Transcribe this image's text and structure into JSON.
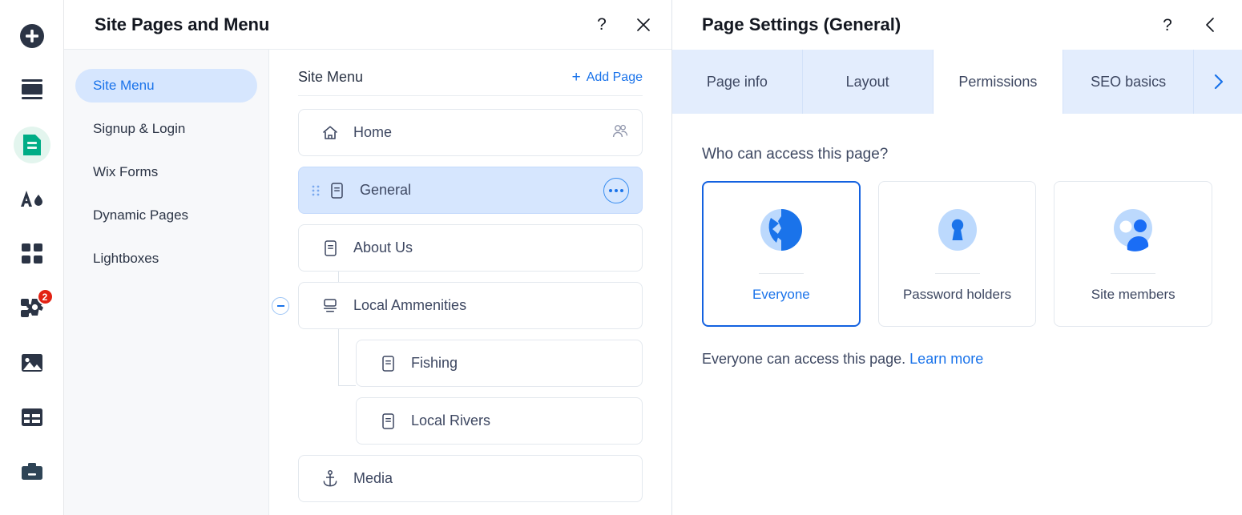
{
  "rail": {
    "items": [
      {
        "name": "add-elements",
        "icon": "plus-circle-icon",
        "active": false,
        "badge": null
      },
      {
        "name": "site-design",
        "icon": "layers-icon",
        "active": false,
        "badge": null
      },
      {
        "name": "pages-and-menu",
        "icon": "page-document-icon",
        "active": true,
        "badge": null
      },
      {
        "name": "site-theme",
        "icon": "text-and-color-icon",
        "active": false,
        "badge": null
      },
      {
        "name": "apps",
        "icon": "grid-squares-icon",
        "active": false,
        "badge": null
      },
      {
        "name": "app-market",
        "icon": "puzzle-gear-icon",
        "active": false,
        "badge": "2"
      },
      {
        "name": "media",
        "icon": "image-icon",
        "active": false,
        "badge": null
      },
      {
        "name": "content-manager",
        "icon": "table-icon",
        "active": false,
        "badge": null
      },
      {
        "name": "business-tools",
        "icon": "briefcase-icon",
        "active": false,
        "badge": null
      }
    ]
  },
  "pages_panel": {
    "title": "Site Pages and Menu",
    "help_icon": "?",
    "close_icon": "✕",
    "nav": {
      "items": [
        {
          "label": "Site Menu",
          "active": true
        },
        {
          "label": "Signup & Login",
          "active": false
        },
        {
          "label": "Wix Forms",
          "active": false
        },
        {
          "label": "Dynamic Pages",
          "active": false
        },
        {
          "label": "Lightboxes",
          "active": false
        }
      ]
    },
    "tree": {
      "header": "Site Menu",
      "add_page_label": "Add Page",
      "add_page_icon": "plus-icon",
      "rows": [
        {
          "label": "Home",
          "icon": "home-icon",
          "selected": false,
          "child": false,
          "drag": false,
          "right_icon": "members-icon",
          "toggle": null
        },
        {
          "label": "General",
          "icon": "page-icon",
          "selected": true,
          "child": false,
          "drag": true,
          "right_icon": "more-actions-icon",
          "toggle": null
        },
        {
          "label": "About Us",
          "icon": "page-icon",
          "selected": false,
          "child": false,
          "drag": false,
          "right_icon": null,
          "toggle": null
        },
        {
          "label": "Local Ammenities",
          "icon": "dropdown-folder-icon",
          "selected": false,
          "child": false,
          "drag": false,
          "right_icon": null,
          "toggle": "collapse"
        },
        {
          "label": "Fishing",
          "icon": "page-icon",
          "selected": false,
          "child": true,
          "drag": false,
          "right_icon": null,
          "toggle": null
        },
        {
          "label": "Local Rivers",
          "icon": "page-icon",
          "selected": false,
          "child": true,
          "drag": false,
          "right_icon": null,
          "toggle": null
        },
        {
          "label": "Media",
          "icon": "anchor-icon",
          "selected": false,
          "child": false,
          "drag": false,
          "right_icon": null,
          "toggle": null
        }
      ]
    }
  },
  "settings_panel": {
    "title": "Page Settings (General)",
    "help_icon": "?",
    "back_icon": "chevron-left-icon",
    "tabs": [
      {
        "label": "Page info",
        "active": false
      },
      {
        "label": "Layout",
        "active": false
      },
      {
        "label": "Permissions",
        "active": true
      },
      {
        "label": "SEO basics",
        "active": false
      }
    ],
    "tabs_next_icon": "chevron-right-icon",
    "question": "Who can access this page?",
    "permission_options": [
      {
        "label": "Everyone",
        "icon": "globe-icon",
        "selected": true
      },
      {
        "label": "Password holders",
        "icon": "keyhole-icon",
        "selected": false
      },
      {
        "label": "Site members",
        "icon": "people-icon",
        "selected": false
      }
    ],
    "note_text": "Everyone can access this page.",
    "note_link": "Learn more"
  },
  "colors": {
    "accent_blue": "#1a73ea",
    "selected_row_bg": "#d6e6fe",
    "active_rail_green": "#00ad86",
    "badge_red": "#e22213",
    "tabs_bg": "#e3edfd"
  }
}
